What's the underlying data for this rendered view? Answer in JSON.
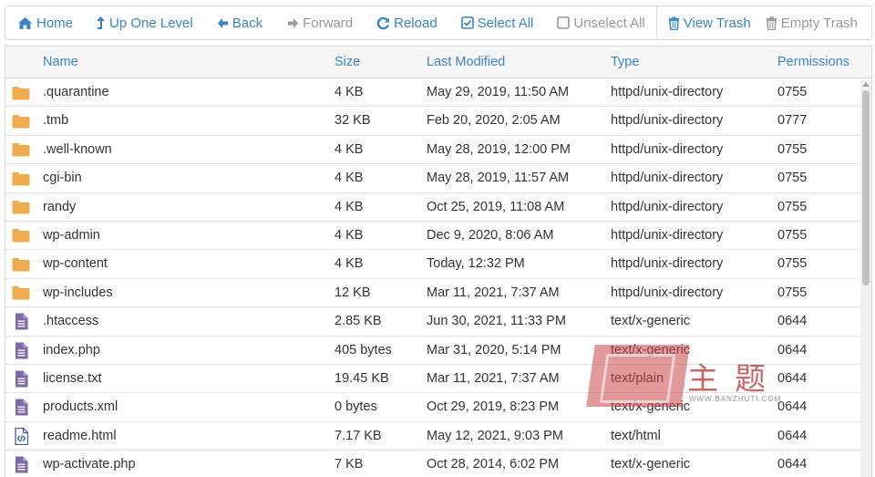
{
  "toolbar": {
    "home": "Home",
    "up_one_level": "Up One Level",
    "back": "Back",
    "forward": "Forward",
    "reload": "Reload",
    "select_all": "Select All",
    "unselect_all": "Unselect All",
    "view_trash": "View Trash",
    "empty_trash": "Empty Trash"
  },
  "columns": {
    "name": "Name",
    "size": "Size",
    "last_modified": "Last Modified",
    "type": "Type",
    "permissions": "Permissions"
  },
  "files": [
    {
      "icon": "folder-icon",
      "name": ".quarantine",
      "size": "4 KB",
      "modified": "May 29, 2019, 11:50 AM",
      "type": "httpd/unix-directory",
      "perms": "0755"
    },
    {
      "icon": "folder-icon",
      "name": ".tmb",
      "size": "32 KB",
      "modified": "Feb 20, 2020, 2:05 AM",
      "type": "httpd/unix-directory",
      "perms": "0777"
    },
    {
      "icon": "folder-icon",
      "name": ".well-known",
      "size": "4 KB",
      "modified": "May 28, 2019, 12:00 PM",
      "type": "httpd/unix-directory",
      "perms": "0755"
    },
    {
      "icon": "folder-icon",
      "name": "cgi-bin",
      "size": "4 KB",
      "modified": "May 28, 2019, 11:57 AM",
      "type": "httpd/unix-directory",
      "perms": "0755"
    },
    {
      "icon": "folder-icon",
      "name": "randy",
      "size": "4 KB",
      "modified": "Oct 25, 2019, 11:08 AM",
      "type": "httpd/unix-directory",
      "perms": "0755"
    },
    {
      "icon": "folder-icon",
      "name": "wp-admin",
      "size": "4 KB",
      "modified": "Dec 9, 2020, 8:06 AM",
      "type": "httpd/unix-directory",
      "perms": "0755"
    },
    {
      "icon": "folder-icon",
      "name": "wp-content",
      "size": "4 KB",
      "modified": "Today, 12:32 PM",
      "type": "httpd/unix-directory",
      "perms": "0755"
    },
    {
      "icon": "folder-icon",
      "name": "wp-includes",
      "size": "12 KB",
      "modified": "Mar 11, 2021, 7:37 AM",
      "type": "httpd/unix-directory",
      "perms": "0755"
    },
    {
      "icon": "file-icon",
      "name": ".htaccess",
      "size": "2.85 KB",
      "modified": "Jun 30, 2021, 11:33 PM",
      "type": "text/x-generic",
      "perms": "0644"
    },
    {
      "icon": "file-icon",
      "name": "index.php",
      "size": "405 bytes",
      "modified": "Mar 31, 2020, 5:14 PM",
      "type": "text/x-generic",
      "perms": "0644"
    },
    {
      "icon": "file-icon",
      "name": "license.txt",
      "size": "19.45 KB",
      "modified": "Mar 11, 2021, 7:37 AM",
      "type": "text/plain",
      "perms": "0644"
    },
    {
      "icon": "file-icon",
      "name": "products.xml",
      "size": "0 bytes",
      "modified": "Oct 29, 2019, 8:23 PM",
      "type": "text/x-generic",
      "perms": "0644"
    },
    {
      "icon": "html-file-icon",
      "name": "readme.html",
      "size": "7.17 KB",
      "modified": "May 12, 2021, 9:03 PM",
      "type": "text/html",
      "perms": "0644"
    },
    {
      "icon": "file-icon",
      "name": "wp-activate.php",
      "size": "7 KB",
      "modified": "Oct 28, 2014, 6:02 PM",
      "type": "text/x-generic",
      "perms": "0644"
    }
  ],
  "watermark": {
    "chars": "主题",
    "url": "WWW.BANZHUTI.COM"
  },
  "colors": {
    "link": "#3a85c6",
    "disabled": "#999999",
    "folder": "#f0ad4e",
    "file": "#7b6aa6"
  }
}
